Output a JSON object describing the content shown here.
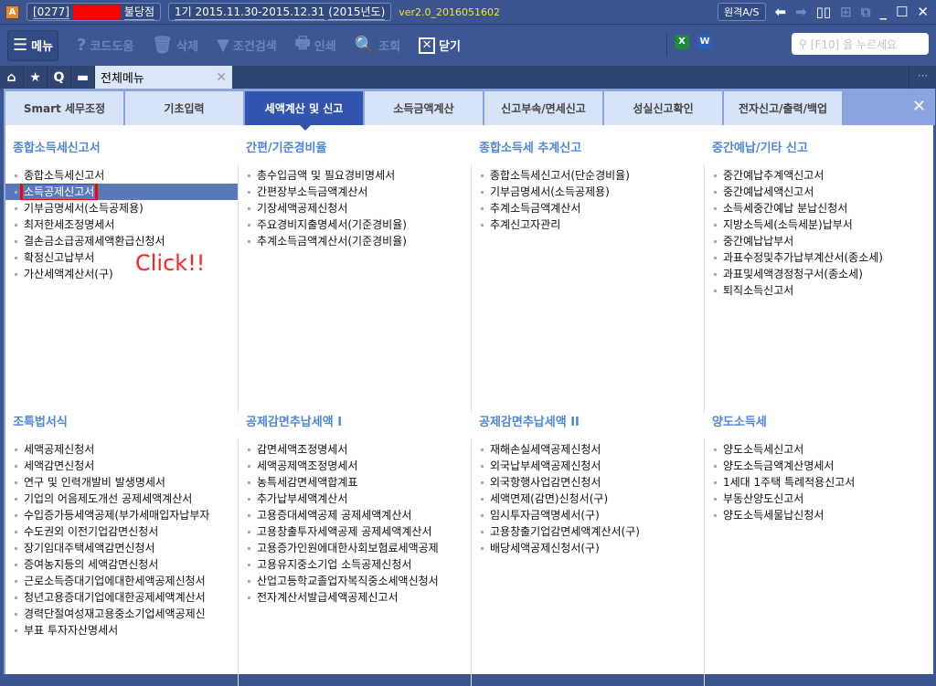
{
  "titlebar": {
    "company_code": "[0277]",
    "branch": "불당점",
    "period": "1기  2015.11.30-2015.12.31",
    "year": "(2015년도)",
    "version": "ver2.0_2016051602",
    "remote_as": "원격A/S"
  },
  "toolbar": {
    "menu": "메뉴",
    "code_help": "코드도움",
    "delete": "삭제",
    "filter": "조건검색",
    "print": "인쇄",
    "query": "조회",
    "close": "닫기",
    "search_placeholder": "[F10] 을 누르세요"
  },
  "doc_tab": {
    "label": "전체메뉴"
  },
  "menu_tabs": [
    "Smart 세무조정",
    "기초입력",
    "세액계산 및 신고",
    "소득금액계산",
    "신고부속/면세신고",
    "성실신고확인",
    "전자신고/출력/백업"
  ],
  "active_tab": 2,
  "annotation": "Click!!",
  "sections": [
    {
      "title": "종합소득세신고서",
      "items": [
        "종합소득세신고서",
        "소득공제신고서",
        "기부금명세서(소득공제용)",
        "최저한세조정명세서",
        "결손금소급공제세액환급신청서",
        "확정신고납부서",
        "가산세액계산서(구)"
      ],
      "selected": 1
    },
    {
      "title": "간편/기준경비율",
      "items": [
        "총수입금액 및 필요경비명세서",
        "간편장부소득금액계산서",
        "기장세액공제신청서",
        "주요경비지출명세서(기준경비율)",
        "추계소득금액계산서(기준경비율)"
      ]
    },
    {
      "title": "종합소득세 추계신고",
      "items": [
        "종합소득세신고서(단순경비율)",
        "기부금명세서(소득공제용)",
        "추계소득금액계산서",
        "추계신고자관리"
      ]
    },
    {
      "title": "중간예납/기타 신고",
      "items": [
        "중간예납추계액신고서",
        "중간예납세액신고서",
        "소득세중간예납 분납신청서",
        "지방소득세(소득세분)납부서",
        "중간예납납부서",
        "과표수정및추가납부계산서(종소세)",
        "과표및세액경정청구서(종소세)",
        "퇴직소득신고서"
      ]
    },
    {
      "title": "조특법서식",
      "items": [
        "세액공제신청서",
        "세액감면신청서",
        "연구 및 인력개발비 발생명세서",
        "기업의 어음제도개선 공제세액계산서",
        "수입증가등세액공제(부가세매입자납부자",
        "수도권외 이전기업감면신청서",
        "장기임대주택세액감면신청서",
        "증여농지등의 세액감면신청서",
        "근로소득증대기업에대한세액공제신청서",
        "청년고용증대기업에대한공제세액계산서",
        "경력단절여성재고용중소기업세액공제신",
        "부표 투자자산명세서"
      ]
    },
    {
      "title": "공제감면추납세액 I",
      "items": [
        "감면세액조정명세서",
        "세액공제액조정명세서",
        "농특세감면세액합계표",
        "추가납부세액계산서",
        "고용증대세액공제 공제세액계산서",
        "고용창출투자세액공제 공제세액계산서",
        "고용증가인원에대한사회보험료세액공제",
        "고용유지중소기업 소득공제신청서",
        "산업고등학교졸업자복직중소세액신청서",
        "전자계산서발급세액공제신고서"
      ]
    },
    {
      "title": "공제감면추납세액 II",
      "items": [
        "재해손실세액공제신청서",
        "외국납부세액공제신청서",
        "외국항행사업감면신청서",
        "세액면제(감면)신청서(구)",
        "임시투자금액명세서(구)",
        "고용창출기업감면세액계산서(구)",
        "배당세액공제신청서(구)"
      ]
    },
    {
      "title": "양도소득세",
      "items": [
        "양도소득세신고서",
        "양도소득금액계산명세서",
        "1세대 1주택 특례적용신고서",
        "부동산양도신고서",
        "양도소득세물납신청서"
      ]
    }
  ]
}
